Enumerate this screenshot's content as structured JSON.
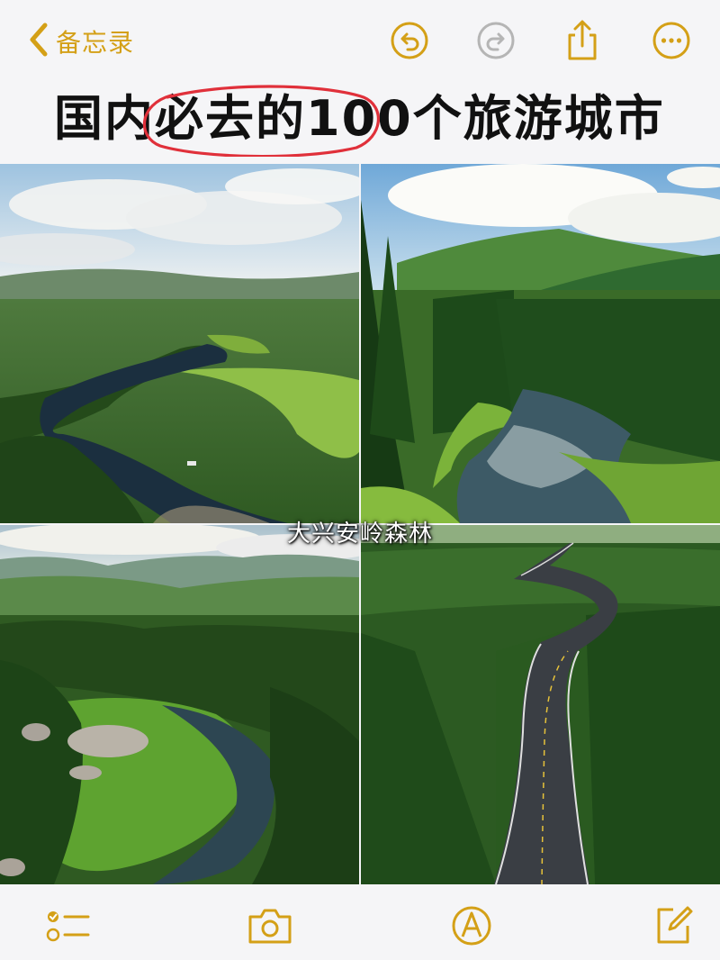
{
  "nav": {
    "back_label": "备忘录",
    "icons": [
      "undo-icon",
      "redo-icon",
      "share-icon",
      "more-icon"
    ]
  },
  "note": {
    "title": "国内必去的100个旅游城市",
    "highlight": "必去的100"
  },
  "photos": {
    "caption": "大兴安岭森林",
    "items": [
      "river-valley-forest-photo",
      "mountain-stream-forest-photo",
      "hills-river-meadow-photo",
      "forest-road-photo"
    ]
  },
  "toolbar": {
    "icons": [
      "checklist-icon",
      "camera-icon",
      "markup-icon",
      "compose-icon"
    ]
  },
  "colors": {
    "accent": "#d4a017",
    "highlight_circle": "#e0303a",
    "disabled": "#b5b5b5"
  }
}
